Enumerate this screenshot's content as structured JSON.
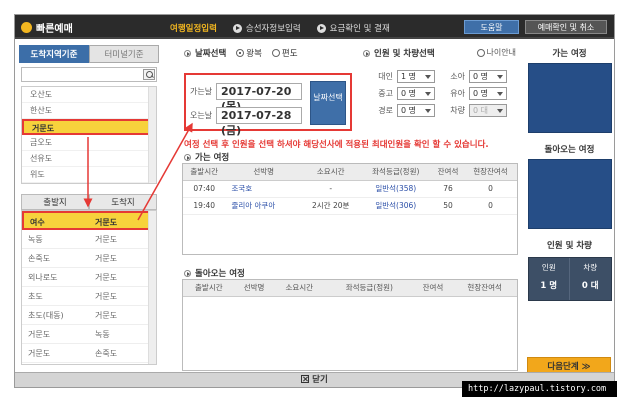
{
  "app": {
    "title": "빠른예매"
  },
  "steps": [
    {
      "label": "여행일정입력",
      "active": true
    },
    {
      "label": "승선자정보입력",
      "active": false
    },
    {
      "label": "요금확인 및 결재",
      "active": false
    }
  ],
  "header": {
    "help_label": "도움말",
    "confirm_label": "예매확인 및 취소"
  },
  "left": {
    "tabs": [
      "도착지역기준",
      "터미널기준"
    ],
    "search_placeholder": "",
    "arrival_list": [
      "오산도",
      "한산도",
      "거문도",
      "금오도",
      "선유도",
      "위도"
    ],
    "route_headers": [
      "출발지",
      "도착지"
    ],
    "routes": [
      {
        "from": "여수",
        "to": "거문도"
      },
      {
        "from": "녹동",
        "to": "거문도"
      },
      {
        "from": "손죽도",
        "to": "거문도"
      },
      {
        "from": "외나로도",
        "to": "거문도"
      },
      {
        "from": "초도",
        "to": "거문도"
      },
      {
        "from": "초도(대동)",
        "to": "거문도"
      },
      {
        "from": "거문도",
        "to": "녹동"
      },
      {
        "from": "거문도",
        "to": "손죽도"
      }
    ]
  },
  "date_section": {
    "title": "날짜선택",
    "opt_round": "왕복",
    "opt_oneway": "편도",
    "depart_label": "가는날",
    "depart_value": "2017-07-20 (목)",
    "return_label": "오는날",
    "return_value": "2017-07-28 (금)",
    "button_label": "날짜선택"
  },
  "pax_section": {
    "title": "인원 및 차량선택",
    "age_guide": "나이안내",
    "rows": [
      [
        {
          "label": "대인",
          "value": "1 명"
        },
        {
          "label": "소아",
          "value": "0 명"
        }
      ],
      [
        {
          "label": "중고",
          "value": "0 명"
        },
        {
          "label": "유아",
          "value": "0 명"
        }
      ],
      [
        {
          "label": "경로",
          "value": "0 명"
        },
        {
          "label": "차량",
          "value": "0 대"
        }
      ]
    ]
  },
  "notice": "여정 선택 후 인원을 선택 하셔야 해당선사에 적용된 최대인원을 확인 할 수 있습니다.",
  "outbound": {
    "title": "가는 여정",
    "headers": [
      "출발시간",
      "선박명",
      "소요시간",
      "좌석등급(정원)",
      "잔여석",
      "현장잔여석"
    ],
    "rows": [
      [
        "07:40",
        "조국호",
        "-",
        "일반석(358)",
        "76",
        "0"
      ],
      [
        "19:40",
        "줄리아 아쿠아",
        "2시간 20분",
        "일반석(306)",
        "50",
        "0"
      ]
    ]
  },
  "inbound": {
    "title": "돌아오는 여정",
    "headers": [
      "출발시간",
      "선박명",
      "소요시간",
      "좌석등급(정원)",
      "잔여석",
      "현장잔여석"
    ]
  },
  "right": {
    "outbound_title": "가는 여정",
    "inbound_title": "돌아오는 여정",
    "pax_title": "인원 및 차량",
    "pax_label": "인원",
    "pax_value": "1 명",
    "car_label": "차량",
    "car_value": "0 대",
    "next_label": "다음단계 ≫"
  },
  "footer": {
    "close_label": "닫기"
  },
  "watermark": "http://lazypaul.tistory.com",
  "colors": {
    "accent": "#f2b620",
    "brand_blue": "#264e87",
    "highlight_red": "#e53935",
    "next_orange": "#f2a71b"
  }
}
